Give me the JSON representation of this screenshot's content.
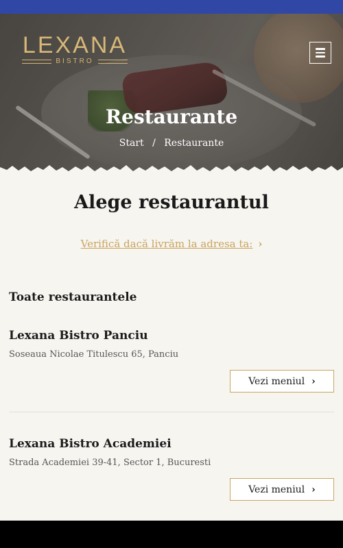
{
  "brand": {
    "logo_text": "LEXANA",
    "logo_sub": "BISTRO",
    "gold_color": "#d7b878"
  },
  "header": {
    "menu_icon": "hamburger-icon"
  },
  "hero": {
    "title": "Restaurante",
    "breadcrumb": {
      "home": "Start",
      "separator": "/",
      "current": "Restaurante"
    }
  },
  "page": {
    "title": "Alege restaurantul",
    "check_address_link": "Verifică dacă livrăm la adresa ta:",
    "section_title": "Toate restaurantele"
  },
  "restaurants": [
    {
      "name": "Lexana Bistro Panciu",
      "address": "Soseaua Nicolae Titulescu 65, Panciu",
      "button": "Vezi meniul"
    },
    {
      "name": "Lexana Bistro Academiei",
      "address": "Strada Academiei 39-41, Sector 1, Bucuresti",
      "button": "Vezi meniul"
    }
  ],
  "colors": {
    "status_bar": "#3047a6",
    "accent": "#c9a460",
    "background": "#f7f5f0"
  }
}
